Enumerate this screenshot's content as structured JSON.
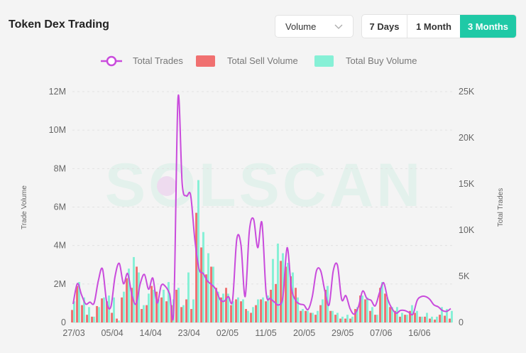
{
  "header": {
    "title": "Token Dex Trading",
    "metric_select": "Volume",
    "ranges": [
      "7 Days",
      "1 Month",
      "3 Months"
    ],
    "active_range": "3 Months"
  },
  "watermark": "SOLSCAN",
  "colors": {
    "trades": "#c94bdc",
    "sell": "#f07070",
    "buy": "#86f0d6",
    "accent": "#1fc9a6"
  },
  "chart_data": {
    "type": "bar+line",
    "legend": [
      "Total Trades",
      "Total Sell Volume",
      "Total Buy Volume"
    ],
    "legend_position": "top-center",
    "ylabel_left": "Trade Volume",
    "ylabel_right": "Total Trades",
    "left_ticks": [
      "0",
      "2M",
      "4M",
      "6M",
      "8M",
      "10M",
      "12M"
    ],
    "right_ticks": [
      "0",
      "5K",
      "10K",
      "15K",
      "20K",
      "25K"
    ],
    "x_ticks": [
      "27/03",
      "05/04",
      "14/04",
      "23/04",
      "02/05",
      "11/05",
      "20/05",
      "29/05",
      "07/06",
      "16/06"
    ],
    "ylim_left": [
      0,
      12000000
    ],
    "ylim_right": [
      0,
      25000
    ],
    "grid": true,
    "series": [
      {
        "name": "Total Sell Volume",
        "values": [
          650000,
          1900000,
          900000,
          400000,
          300000,
          850000,
          1250000,
          1100000,
          500000,
          200000,
          1300000,
          2300000,
          1800000,
          2900000,
          700000,
          900000,
          1900000,
          1600000,
          1300000,
          1100000,
          900000,
          1700000,
          800000,
          1200000,
          700000,
          5700000,
          3900000,
          2500000,
          2900000,
          1800000,
          1300000,
          1800000,
          900000,
          1200000,
          1100000,
          700000,
          500000,
          900000,
          1200000,
          1100000,
          1700000,
          2000000,
          3200000,
          2900000,
          2400000,
          1800000,
          600000,
          600000,
          500000,
          400000,
          900000,
          1700000,
          600000,
          400000,
          200000,
          200000,
          200000,
          700000,
          1400000,
          1200000,
          600000,
          400000,
          1800000,
          1500000,
          800000,
          600000,
          300000,
          400000,
          600000,
          500000,
          300000,
          300000,
          200000,
          150000,
          400000,
          350000,
          200000
        ]
      },
      {
        "name": "Total Buy Volume",
        "values": [
          1100000,
          2100000,
          1300000,
          800000,
          300000,
          800000,
          1300000,
          1400000,
          1300000,
          100000,
          1600000,
          2800000,
          3400000,
          2600000,
          900000,
          1500000,
          1700000,
          1200000,
          1700000,
          2100000,
          1200000,
          1800000,
          900000,
          2600000,
          1200000,
          7400000,
          4700000,
          3600000,
          2900000,
          1600000,
          1500000,
          1500000,
          1100000,
          1300000,
          1200000,
          600000,
          800000,
          1200000,
          1300000,
          1400000,
          3300000,
          4100000,
          3600000,
          3100000,
          2600000,
          1300000,
          700000,
          600000,
          500000,
          600000,
          1200000,
          1900000,
          600000,
          500000,
          300000,
          400000,
          300000,
          800000,
          1400000,
          1300000,
          800000,
          400000,
          2100000,
          1300000,
          800000,
          800000,
          500000,
          400000,
          900000,
          600000,
          300000,
          500000,
          300000,
          300000,
          800000,
          700000,
          600000
        ]
      },
      {
        "name": "Total Trades",
        "values": [
          2000,
          4200,
          3000,
          2000,
          2200,
          2100,
          4500,
          5800,
          2200,
          1700,
          5000,
          6400,
          4200,
          5300,
          3000,
          2000,
          4200,
          5200,
          3600,
          4800,
          2100,
          4000,
          3900,
          3100,
          1600,
          24300,
          15000,
          13700,
          13800,
          9000,
          5800,
          5300,
          4500,
          4100,
          3600,
          2500,
          2300,
          2800,
          2400,
          9000,
          8400,
          2800,
          9900,
          11200,
          8100,
          10800,
          3200,
          2600,
          2200,
          1900,
          2800,
          8100,
          3800,
          2400,
          2000,
          1900,
          1400,
          2800,
          5600,
          5600,
          3400,
          1900,
          5600,
          6200,
          2500,
          2900,
          1500,
          900,
          1700,
          3400,
          2600,
          2400,
          1800,
          3200,
          4300,
          2500,
          1500,
          1000,
          1300,
          1300,
          1100,
          900,
          2400,
          2800,
          2800,
          2500,
          1900,
          1700,
          1300,
          1200,
          1500
        ]
      }
    ]
  }
}
